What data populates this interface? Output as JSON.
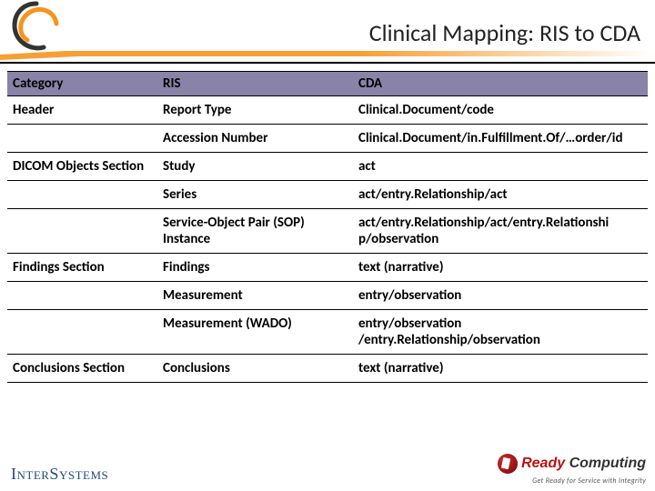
{
  "title": "Clinical Mapping:  RIS to CDA",
  "columns": {
    "cat": "Category",
    "ris": "RIS",
    "cda": "CDA"
  },
  "rows": [
    {
      "cat": "Header",
      "ris": "Report Type",
      "cda": "Clinical.Document/code"
    },
    {
      "cat": "",
      "ris": "Accession Number",
      "cda": "Clinical.Document/in.Fulfillment.Of/…order/id"
    },
    {
      "cat": "DICOM Objects Section",
      "ris": "Study",
      "cda": "act"
    },
    {
      "cat": "",
      "ris": "Series",
      "cda": "act/entry.Relationship/act"
    },
    {
      "cat": "",
      "ris": "Service-Object Pair (SOP) Instance",
      "cda": "act/entry.Relationship/act/entry.Relationshi p/observation"
    },
    {
      "cat": "Findings Section",
      "ris": "Findings",
      "cda": "text (narrative)"
    },
    {
      "cat": "",
      "ris": "Measurement",
      "cda": "entry/observation"
    },
    {
      "cat": "",
      "ris": "Measurement (WADO)",
      "cda": "entry/observation /entry.Relationship/observation"
    },
    {
      "cat": "Conclusions Section",
      "ris": "Conclusions",
      "cda": "text (narrative)"
    }
  ],
  "footer": {
    "left": "InterSystems",
    "right_brand1": "Ready",
    "right_brand2": "Computing",
    "right_tag": "Get Ready for Service with Integrity"
  }
}
